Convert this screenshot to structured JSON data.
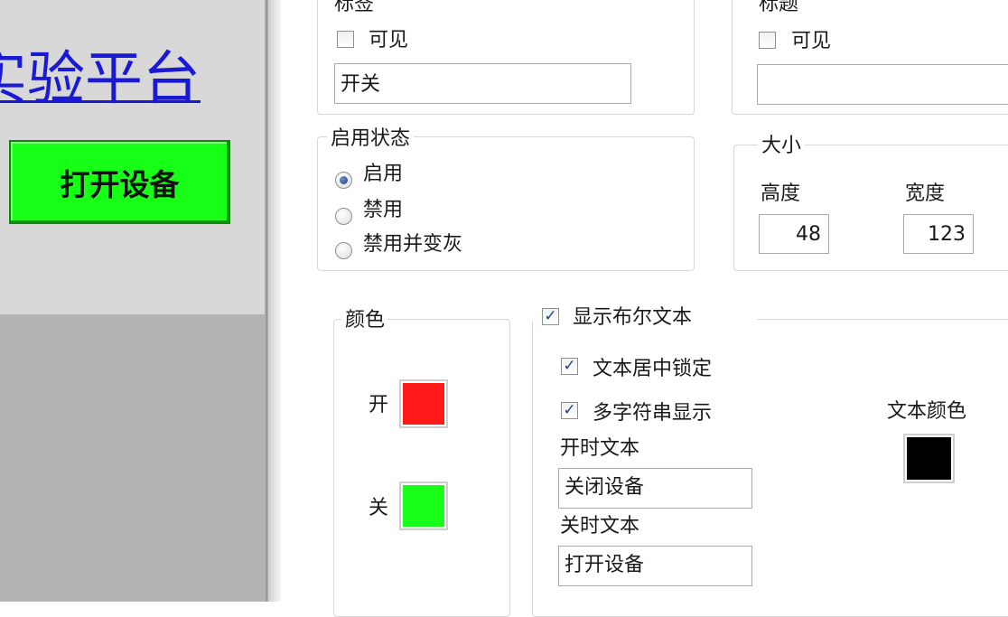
{
  "preview": {
    "platform_title": "实验平台",
    "button_label": "打开设备",
    "button_color": "#17ff17"
  },
  "label_group": {
    "legend": "标签",
    "visible_label": "可见",
    "visible_checked": false,
    "text_value": "开关"
  },
  "title_group": {
    "legend": "标题",
    "visible_label": "可见",
    "visible_checked": false,
    "text_value": ""
  },
  "enable_state": {
    "legend": "启用状态",
    "options": [
      "启用",
      "禁用",
      "禁用并变灰"
    ],
    "selected": "启用"
  },
  "size": {
    "legend": "大小",
    "height_label": "高度",
    "height_value": "48",
    "width_label": "宽度",
    "width_value": "123"
  },
  "colors": {
    "legend": "颜色",
    "on_label": "开",
    "on_color": "#ff1a1a",
    "off_label": "关",
    "off_color": "#1aff1a"
  },
  "bool_text": {
    "show_label": "显示布尔文本",
    "show_checked": true,
    "center_lock_label": "文本居中锁定",
    "center_lock_checked": true,
    "multi_string_label": "多字符串显示",
    "multi_string_checked": true,
    "on_text_label": "开时文本",
    "on_text_value": "关闭设备",
    "off_text_label": "关时文本",
    "off_text_value": "打开设备",
    "text_color_label": "文本颜色",
    "text_color": "#000000"
  }
}
